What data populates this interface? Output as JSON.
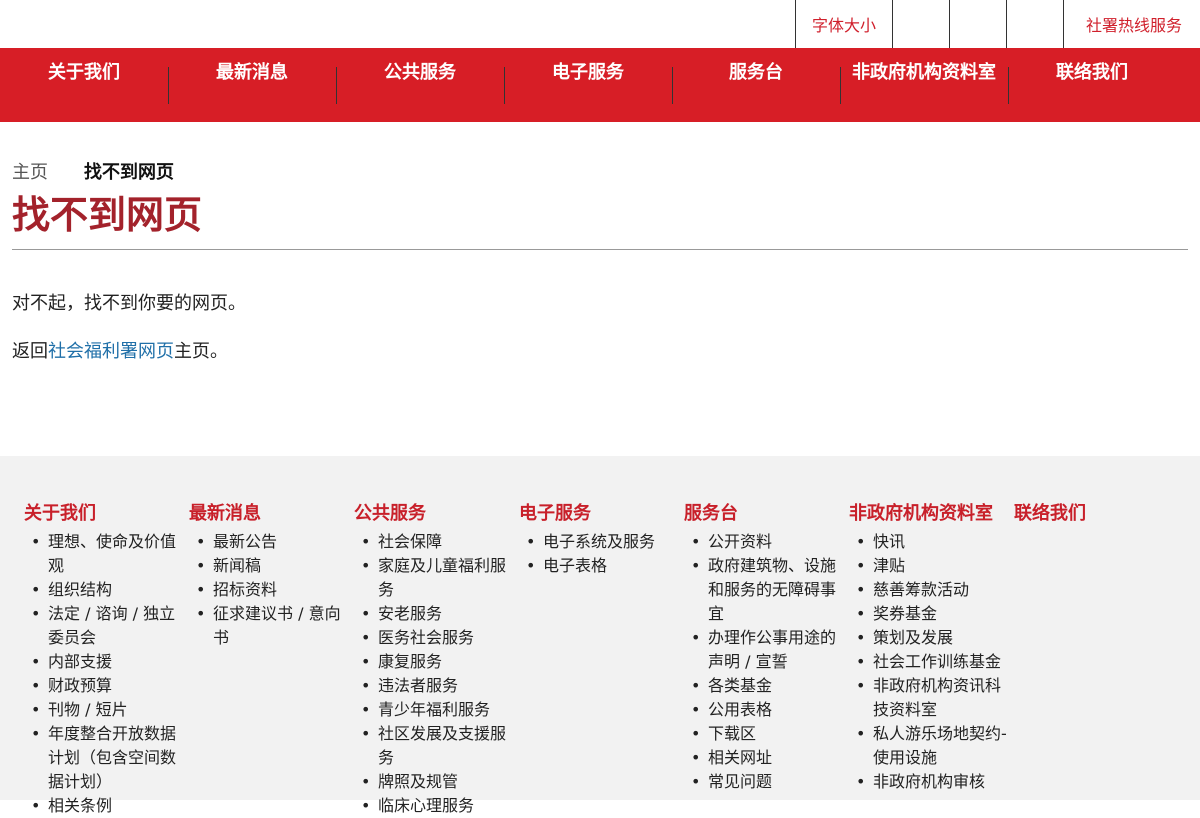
{
  "utility": {
    "font_size": "字体大小",
    "hotline": "社署热线服务"
  },
  "nav": [
    "关于我们",
    "最新消息",
    "公共服务",
    "电子服务",
    "服务台",
    "非政府机构资料室",
    "联络我们"
  ],
  "breadcrumb": {
    "home": "主页",
    "current": "找不到网页"
  },
  "page_title": "找不到网页",
  "message": {
    "line1": "对不起，找不到你要的网页。",
    "line2_prefix": "返回",
    "line2_link": "社会福利署网页",
    "line2_suffix": "主页。"
  },
  "footer": [
    {
      "title": "关于我们",
      "items": [
        "理想、使命及价值观",
        "组织结构",
        "法定 / 谘询 / 独立委员会",
        "内部支援",
        "财政预算",
        "刊物 / 短片",
        "年度整合开放数据计划（包含空间数据计划）",
        "相关条例"
      ]
    },
    {
      "title": "最新消息",
      "items": [
        "最新公告",
        "新闻稿",
        "招标资料",
        "征求建议书 / 意向书"
      ]
    },
    {
      "title": "公共服务",
      "items": [
        "社会保障",
        "家庭及儿童福利服务",
        "安老服务",
        "医务社会服务",
        "康复服务",
        "违法者服务",
        "青少年福利服务",
        "社区发展及支援服务",
        "牌照及规管",
        "临床心理服务"
      ]
    },
    {
      "title": "电子服务",
      "items": [
        "电子系统及服务",
        "电子表格"
      ]
    },
    {
      "title": "服务台",
      "items": [
        "公开资料",
        "政府建筑物、设施和服务的无障碍事宜",
        "办理作公事用途的声明 / 宣誓",
        "各类基金",
        "公用表格",
        "下载区",
        "相关网址",
        "常见问题"
      ]
    },
    {
      "title": "非政府机构资料室",
      "items": [
        "快讯",
        "津贴",
        "慈善筹款活动",
        "奖券基金",
        "策划及发展",
        "社会工作训练基金",
        "非政府机构资讯科技资料室",
        "私人游乐场地契约-使用设施",
        "非政府机构审核"
      ]
    },
    {
      "title": "联络我们",
      "items": []
    }
  ]
}
